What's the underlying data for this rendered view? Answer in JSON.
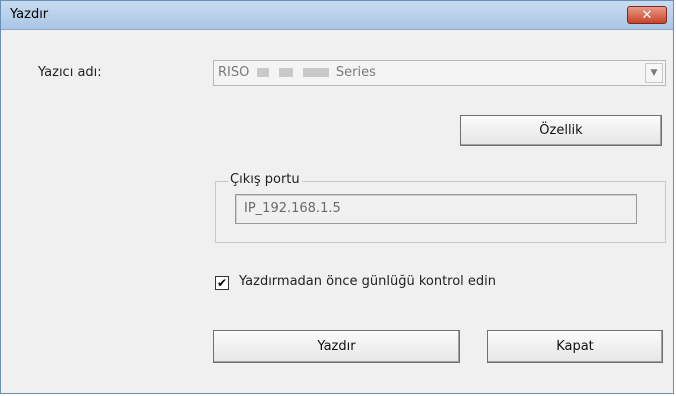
{
  "window": {
    "title": "Yazdır",
    "close_symbol": "✕"
  },
  "printer": {
    "label": "Yazıcı adı:",
    "name_prefix": "RISO",
    "name_suffix": "Series",
    "dropdown_arrow": "▼"
  },
  "properties_button": "Özellik",
  "output_port": {
    "legend": "Çıkış portu",
    "value": "IP_192.168.1.5"
  },
  "log_check": {
    "checked": true,
    "mark": "✔",
    "label": "Yazdırmadan önce günlüğü kontrol edin"
  },
  "buttons": {
    "print": "Yazdır",
    "close": "Kapat"
  }
}
